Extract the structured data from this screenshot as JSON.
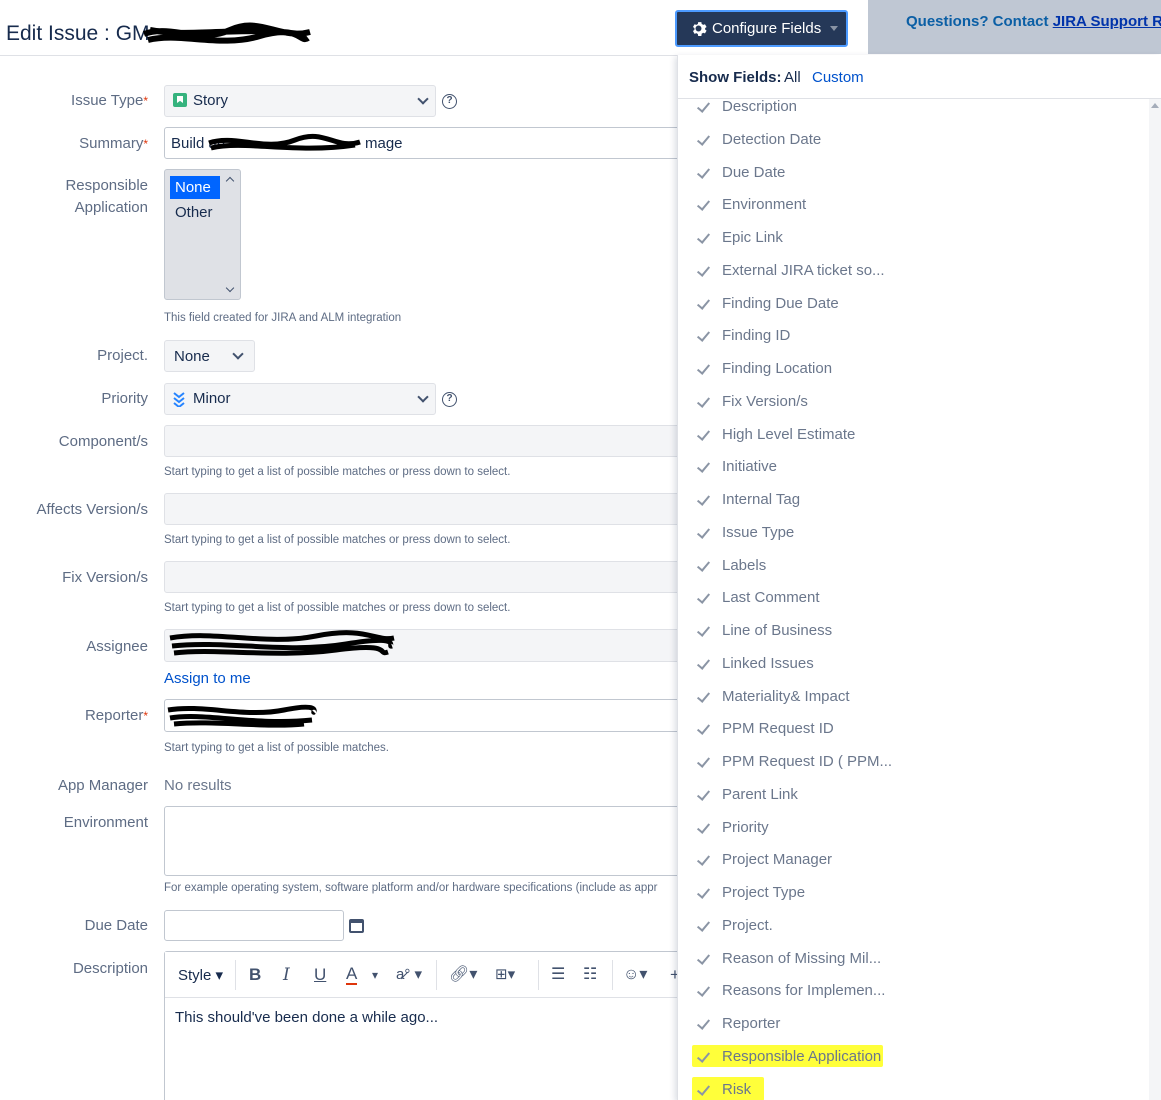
{
  "header": {
    "title": "Edit Issue : GM",
    "configure_label": "Configure Fields",
    "support_text": "Questions? Contact ",
    "support_link": "JIRA Support Req"
  },
  "form": {
    "issue_type": {
      "label": "Issue Type",
      "value": "Story"
    },
    "summary": {
      "label": "Summary",
      "value_start": "Build an",
      "value_end": "mage"
    },
    "responsible_app": {
      "label_1": "Responsible",
      "label_2": "Application",
      "options": [
        "None",
        "Other"
      ],
      "help": "This field created for JIRA and ALM integration"
    },
    "project": {
      "label": "Project.",
      "value": "None"
    },
    "priority": {
      "label": "Priority",
      "value": "Minor"
    },
    "components": {
      "label": "Component/s",
      "help": "Start typing to get a list of possible matches or press down to select."
    },
    "affects": {
      "label": "Affects Version/s",
      "help": "Start typing to get a list of possible matches or press down to select."
    },
    "fix": {
      "label": "Fix Version/s",
      "help": "Start typing to get a list of possible matches or press down to select."
    },
    "assignee": {
      "label": "Assignee",
      "assign_me": "Assign to me"
    },
    "reporter": {
      "label": "Reporter",
      "help": "Start typing to get a list of possible matches."
    },
    "app_manager": {
      "label": "App Manager",
      "value": "No results"
    },
    "environment": {
      "label": "Environment",
      "help": "For example operating system, software platform and/or hardware specifications (include as appr"
    },
    "due_date": {
      "label": "Due Date"
    },
    "description": {
      "label": "Description",
      "style": "Style",
      "body": "This should've been done a while ago..."
    }
  },
  "panel": {
    "show_label": "Show Fields:",
    "all": "All",
    "custom": "Custom",
    "fields": [
      "Description",
      "Detection Date",
      "Due Date",
      "Environment",
      "Epic Link",
      "External JIRA ticket so...",
      "Finding Due Date",
      "Finding ID",
      "Finding Location",
      "Fix Version/s",
      "High Level Estimate",
      "Initiative",
      "Internal Tag",
      "Issue Type",
      "Labels",
      "Last Comment",
      "Line of Business",
      "Linked Issues",
      "Materiality& Impact",
      "PPM Request ID",
      "PPM Request ID ( PPM...",
      "Parent Link",
      "Priority",
      "Project Manager",
      "Project Type",
      "Project.",
      "Reason of Missing Mil...",
      "Reasons for Implemen...",
      "Reporter",
      "Responsible Application",
      "Risk"
    ]
  },
  "colors": {
    "accent": "#0052cc",
    "header_button": "#253858",
    "highlight": "#ffff00"
  }
}
